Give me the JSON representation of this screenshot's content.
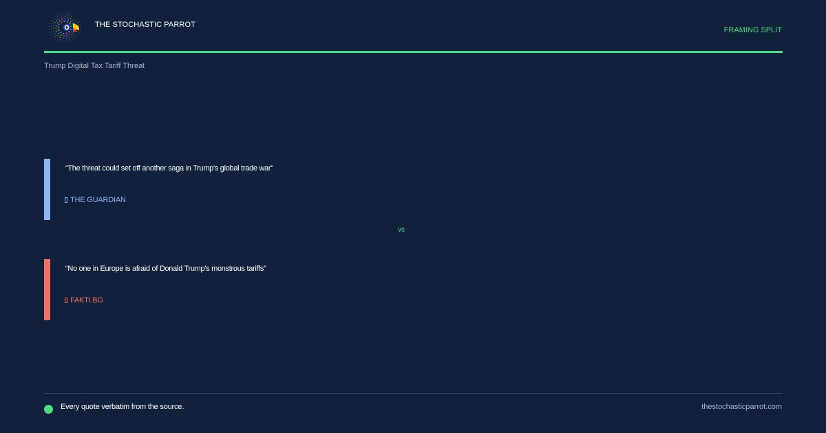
{
  "header": {
    "brand_name": "THE STOCHASTIC PARROT",
    "kicker": "FRAMING SPLIT",
    "logo_icon": "parrot-logo-icon"
  },
  "topic": "Trump Digital Tax Tariff Threat",
  "quotes": [
    {
      "text": "“The threat could set off another saga in Trump's global trade war”",
      "source": "THE GUARDIAN",
      "accent_color": "#8fb4f5",
      "source_icon": "external-link-icon"
    },
    {
      "text": "“No one in Europe is afraid of Donald Trump's monstrous tariffs”",
      "source": "FAKTI.BG",
      "accent_color": "#f07167",
      "source_icon": "external-link-icon"
    }
  ],
  "separator": "vs",
  "footer": {
    "note": "Every quote verbatim from the source.",
    "site": "thestochasticparrot.com"
  },
  "colors": {
    "background": "#11213b",
    "accent_green": "#4ade80",
    "muted_text": "#a8b3c7"
  }
}
